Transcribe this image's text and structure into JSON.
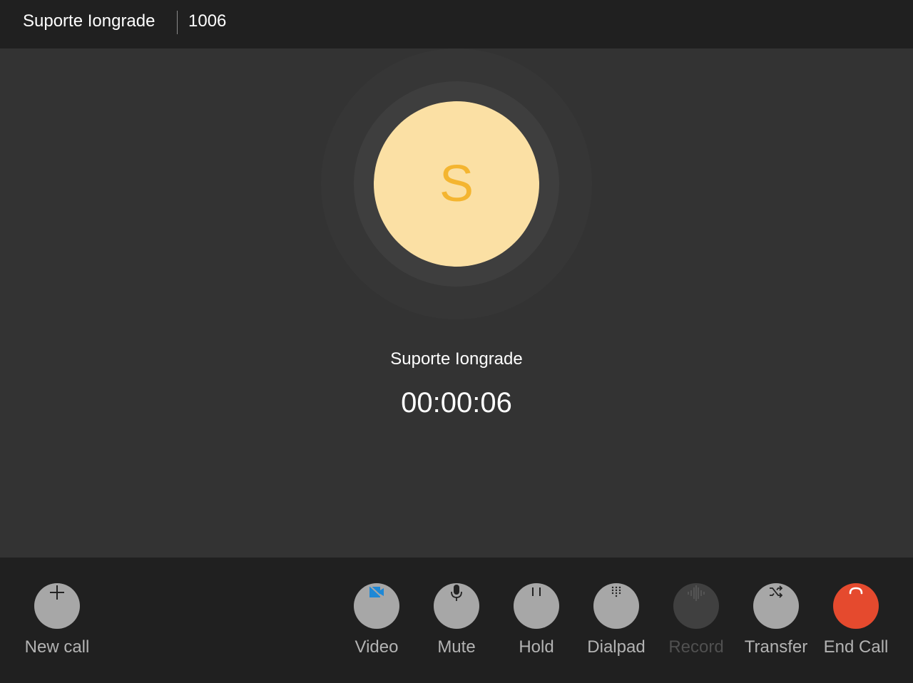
{
  "header": {
    "contact_name": "Suporte Iongrade",
    "extension": "1006"
  },
  "call": {
    "avatar_initial": "S",
    "caller_name": "Suporte Iongrade",
    "duration": "00:00:06"
  },
  "controls": {
    "new_call": {
      "label": "New call",
      "icon": "plus-icon"
    },
    "video": {
      "label": "Video",
      "icon": "video-off-icon"
    },
    "mute": {
      "label": "Mute",
      "icon": "microphone-icon"
    },
    "hold": {
      "label": "Hold",
      "icon": "pause-icon"
    },
    "dialpad": {
      "label": "Dialpad",
      "icon": "dialpad-icon"
    },
    "record": {
      "label": "Record",
      "icon": "waveform-icon",
      "disabled": true
    },
    "transfer": {
      "label": "Transfer",
      "icon": "shuffle-icon"
    },
    "end_call": {
      "label": "End Call",
      "icon": "hangup-icon"
    }
  },
  "colors": {
    "avatar_bg": "#fbe0a4",
    "avatar_letter": "#f4b530",
    "end_call": "#e54a2e",
    "video_icon": "#1e88d6",
    "button_bg": "#a7a7a7"
  }
}
